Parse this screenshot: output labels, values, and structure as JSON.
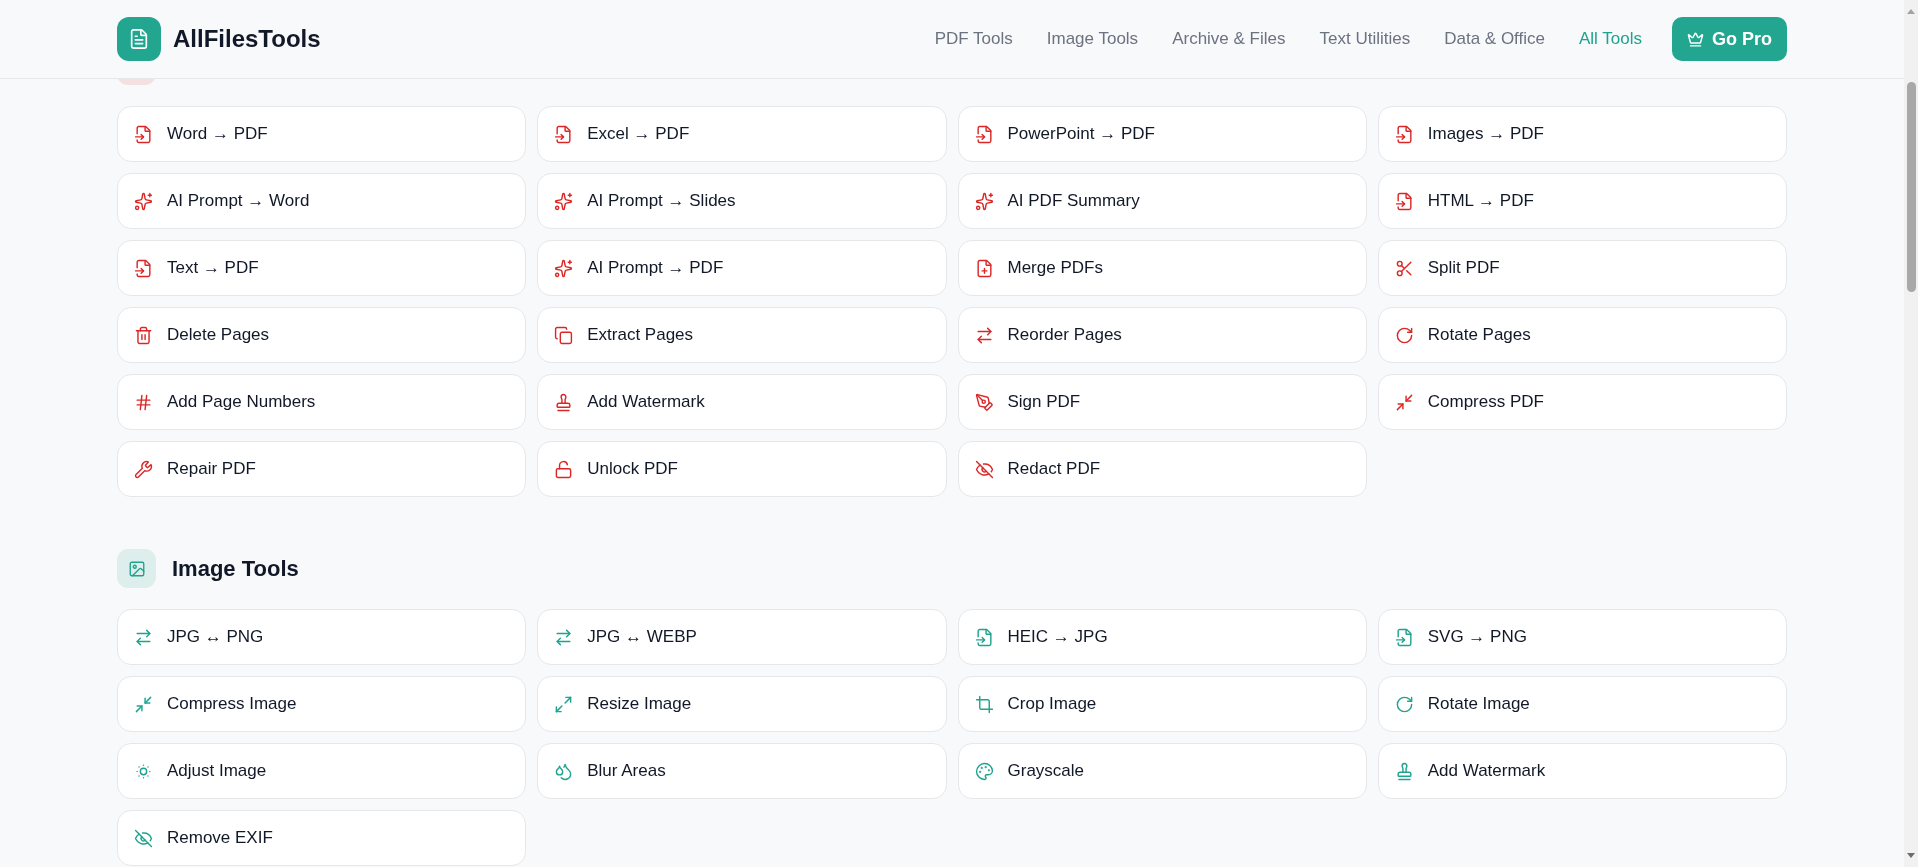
{
  "brand": {
    "name": "AllFilesTools"
  },
  "nav": [
    {
      "label": "PDF Tools",
      "selected": false
    },
    {
      "label": "Image Tools",
      "selected": false
    },
    {
      "label": "Archive & Files",
      "selected": false
    },
    {
      "label": "Text Utilities",
      "selected": false
    },
    {
      "label": "Data & Office",
      "selected": false
    },
    {
      "label": "All Tools",
      "selected": true
    }
  ],
  "cta": {
    "label": "Go Pro"
  },
  "sections": [
    {
      "color": "#dc2626",
      "tools": [
        {
          "label": "Word → PDF",
          "kind": "convert"
        },
        {
          "label": "Excel → PDF",
          "kind": "convert"
        },
        {
          "label": "PowerPoint → PDF",
          "kind": "convert"
        },
        {
          "label": "Images → PDF",
          "kind": "convert"
        },
        {
          "label": "AI Prompt → Word",
          "kind": "ai"
        },
        {
          "label": "AI Prompt → Slides",
          "kind": "ai"
        },
        {
          "label": "AI PDF Summary",
          "kind": "ai"
        },
        {
          "label": "HTML → PDF",
          "kind": "convert"
        },
        {
          "label": "Text → PDF",
          "kind": "convert"
        },
        {
          "label": "AI Prompt → PDF",
          "kind": "ai"
        },
        {
          "label": "Merge PDFs",
          "kind": "merge"
        },
        {
          "label": "Split PDF",
          "kind": "split"
        },
        {
          "label": "Delete Pages",
          "kind": "delete"
        },
        {
          "label": "Extract Pages",
          "kind": "extract"
        },
        {
          "label": "Reorder Pages",
          "kind": "swap"
        },
        {
          "label": "Rotate Pages",
          "kind": "rotate"
        },
        {
          "label": "Add Page Numbers",
          "kind": "numbers"
        },
        {
          "label": "Add Watermark",
          "kind": "stamp"
        },
        {
          "label": "Sign PDF",
          "kind": "sign"
        },
        {
          "label": "Compress PDF",
          "kind": "compress"
        },
        {
          "label": "Repair PDF",
          "kind": "repair"
        },
        {
          "label": "Unlock PDF",
          "kind": "unlock"
        },
        {
          "label": "Redact PDF",
          "kind": "hide"
        }
      ]
    },
    {
      "title": "Image Tools",
      "color": "#1fa38e",
      "tools": [
        {
          "label": "JPG ↔ PNG",
          "kind": "swap"
        },
        {
          "label": "JPG ↔ WEBP",
          "kind": "swap"
        },
        {
          "label": "HEIC → JPG",
          "kind": "convert"
        },
        {
          "label": "SVG → PNG",
          "kind": "convert"
        },
        {
          "label": "Compress Image",
          "kind": "compress"
        },
        {
          "label": "Resize Image",
          "kind": "resize"
        },
        {
          "label": "Crop Image",
          "kind": "crop"
        },
        {
          "label": "Rotate Image",
          "kind": "rotate"
        },
        {
          "label": "Adjust Image",
          "kind": "adjust"
        },
        {
          "label": "Blur Areas",
          "kind": "blur"
        },
        {
          "label": "Grayscale",
          "kind": "palette"
        },
        {
          "label": "Add Watermark",
          "kind": "stamp"
        },
        {
          "label": "Remove EXIF",
          "kind": "hide"
        }
      ]
    }
  ]
}
